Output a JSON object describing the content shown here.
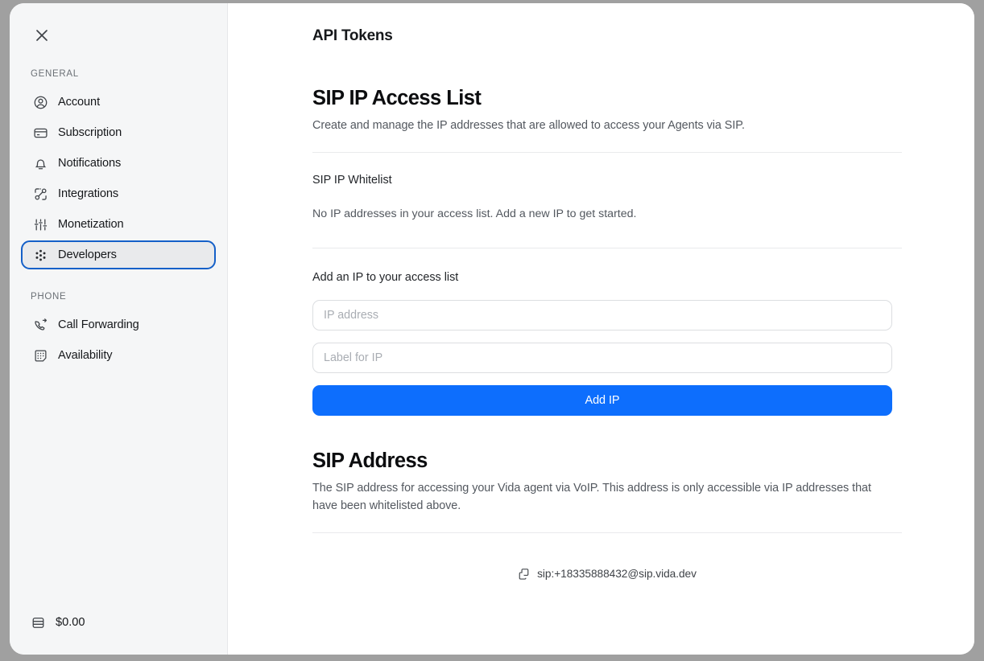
{
  "window": {
    "close_icon": "close-icon"
  },
  "sidebar": {
    "groups": [
      {
        "label": "GENERAL",
        "items": [
          {
            "label": "Account",
            "icon": "user-circle-icon",
            "selected": false
          },
          {
            "label": "Subscription",
            "icon": "credit-card-icon",
            "selected": false
          },
          {
            "label": "Notifications",
            "icon": "bell-icon",
            "selected": false
          },
          {
            "label": "Integrations",
            "icon": "integrations-icon",
            "selected": false
          },
          {
            "label": "Monetization",
            "icon": "sliders-icon",
            "selected": false
          },
          {
            "label": "Developers",
            "icon": "dots-cluster-icon",
            "selected": true
          }
        ]
      },
      {
        "label": "PHONE",
        "items": [
          {
            "label": "Call Forwarding",
            "icon": "phone-forward-icon",
            "selected": false
          },
          {
            "label": "Availability",
            "icon": "keypad-icon",
            "selected": false
          }
        ]
      }
    ],
    "balance": {
      "icon": "wallet-icon",
      "amount": "$0.00"
    },
    "selected_item": "Developers",
    "selection_ring_color": "#1560c8",
    "selection_fill_color": "#e9eaec"
  },
  "main": {
    "page_title": "API Tokens",
    "sections": [
      {
        "title": "SIP IP Access List",
        "description": "Create and manage the IP addresses that are allowed to access your Agents via SIP.",
        "subhead": "SIP IP Whitelist",
        "empty_state": "No IP addresses in your access list. Add a new IP to get started.",
        "form_label": "Add an IP to your access list",
        "fields": [
          {
            "name": "ip-address",
            "placeholder": "IP address",
            "value": ""
          },
          {
            "name": "ip-label",
            "placeholder": "Label for IP",
            "value": ""
          }
        ],
        "submit_label": "Add IP",
        "submit_color": "#0d6efd"
      },
      {
        "title": "SIP Address",
        "description": "The SIP address for accessing your Vida agent via VoIP. This address is only accessible via IP addresses that have been whitelisted above.",
        "sip_address": "sip:+18335888432@sip.vida.dev",
        "copy_icon": "copy-icon"
      }
    ]
  }
}
